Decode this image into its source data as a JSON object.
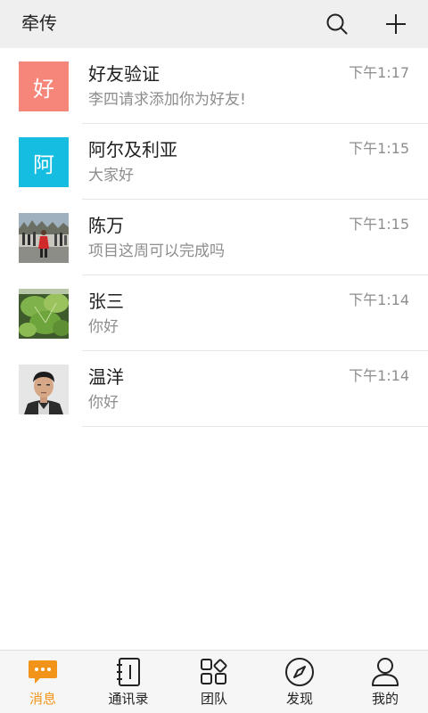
{
  "header": {
    "title": "牵传"
  },
  "conversations": [
    {
      "avatar_text": "好",
      "avatar_color": "#f6857a",
      "name": "好友验证",
      "preview": "李四请求添加你为好友!",
      "time": "下午1:17"
    },
    {
      "avatar_text": "阿",
      "avatar_color": "#15bde0",
      "name": "阿尔及利亚",
      "preview": "大家好",
      "time": "下午1:15"
    },
    {
      "avatar_text": "",
      "name": "陈万",
      "preview": "项目这周可以完成吗",
      "time": "下午1:15"
    },
    {
      "avatar_text": "",
      "name": "张三",
      "preview": "你好",
      "time": "下午1:14"
    },
    {
      "avatar_text": "",
      "name": "温洋",
      "preview": "你好",
      "time": "下午1:14"
    }
  ],
  "tabs": [
    {
      "label": "消息",
      "icon": "message-icon",
      "active": true
    },
    {
      "label": "通讯录",
      "icon": "contacts-icon",
      "active": false
    },
    {
      "label": "团队",
      "icon": "team-icon",
      "active": false
    },
    {
      "label": "发现",
      "icon": "compass-icon",
      "active": false
    },
    {
      "label": "我的",
      "icon": "profile-icon",
      "active": false
    }
  ],
  "colors": {
    "accent": "#f29419",
    "header_bg": "#efefef",
    "tabbar_bg": "#f6f6f6"
  }
}
